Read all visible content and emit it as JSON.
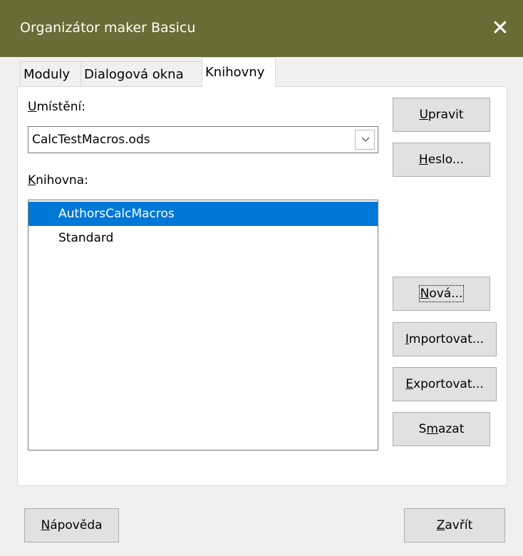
{
  "window": {
    "title": "Organizátor maker Basicu",
    "close_glyph": "✕"
  },
  "tabs": [
    {
      "label": "Moduly"
    },
    {
      "label": "Dialogová okna"
    },
    {
      "label": "Knihovny"
    }
  ],
  "location": {
    "label_mn": "U",
    "label_rest": "místění:",
    "value": "CalcTestMacros.ods"
  },
  "library": {
    "label_mn": "K",
    "label_rest": "nihovna:",
    "items": [
      {
        "label": "AuthorsCalcMacros",
        "selected": true
      },
      {
        "label": "Standard",
        "selected": false
      }
    ]
  },
  "buttons": {
    "edit": {
      "mn": "U",
      "rest": "pravit"
    },
    "password": {
      "mn": "H",
      "rest": "eslo..."
    },
    "new": {
      "mn": "N",
      "rest": "ová..."
    },
    "import": {
      "mn": "I",
      "rest": "mportovat..."
    },
    "export": {
      "mn": "E",
      "rest": "xportovat..."
    },
    "delete": {
      "pre": "S",
      "mn": "m",
      "rest": "azat"
    },
    "help": {
      "mn": "N",
      "rest": "ápověda"
    },
    "close": {
      "mn": "Z",
      "rest": "avřít"
    }
  },
  "colors": {
    "titlebar": "#6b6b35",
    "selection": "#0078d7"
  }
}
